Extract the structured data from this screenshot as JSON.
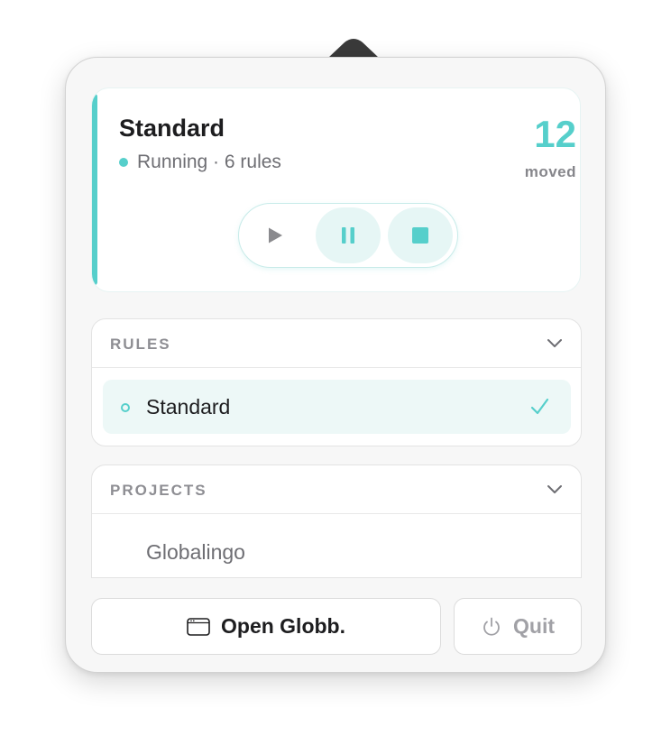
{
  "profile": {
    "title": "Standard",
    "status": "Running · 6 rules",
    "moved_count": "12",
    "moved_label": "moved"
  },
  "controls": {
    "play_icon": "play-icon",
    "pause_icon": "pause-icon",
    "stop_icon": "stop-icon"
  },
  "rules": {
    "title": "RULES",
    "items": [
      {
        "label": "Standard",
        "selected": true
      }
    ]
  },
  "projects": {
    "title": "PROJECTS",
    "items": [
      {
        "label": "Globalingo"
      }
    ]
  },
  "footer": {
    "open_label": "Open Globb.",
    "quit_label": "Quit"
  },
  "colors": {
    "accent": "#56cfcb",
    "accent_tint": "#e6f6f5",
    "text_primary": "#1d1d1f",
    "text_secondary": "#6e6e73"
  }
}
